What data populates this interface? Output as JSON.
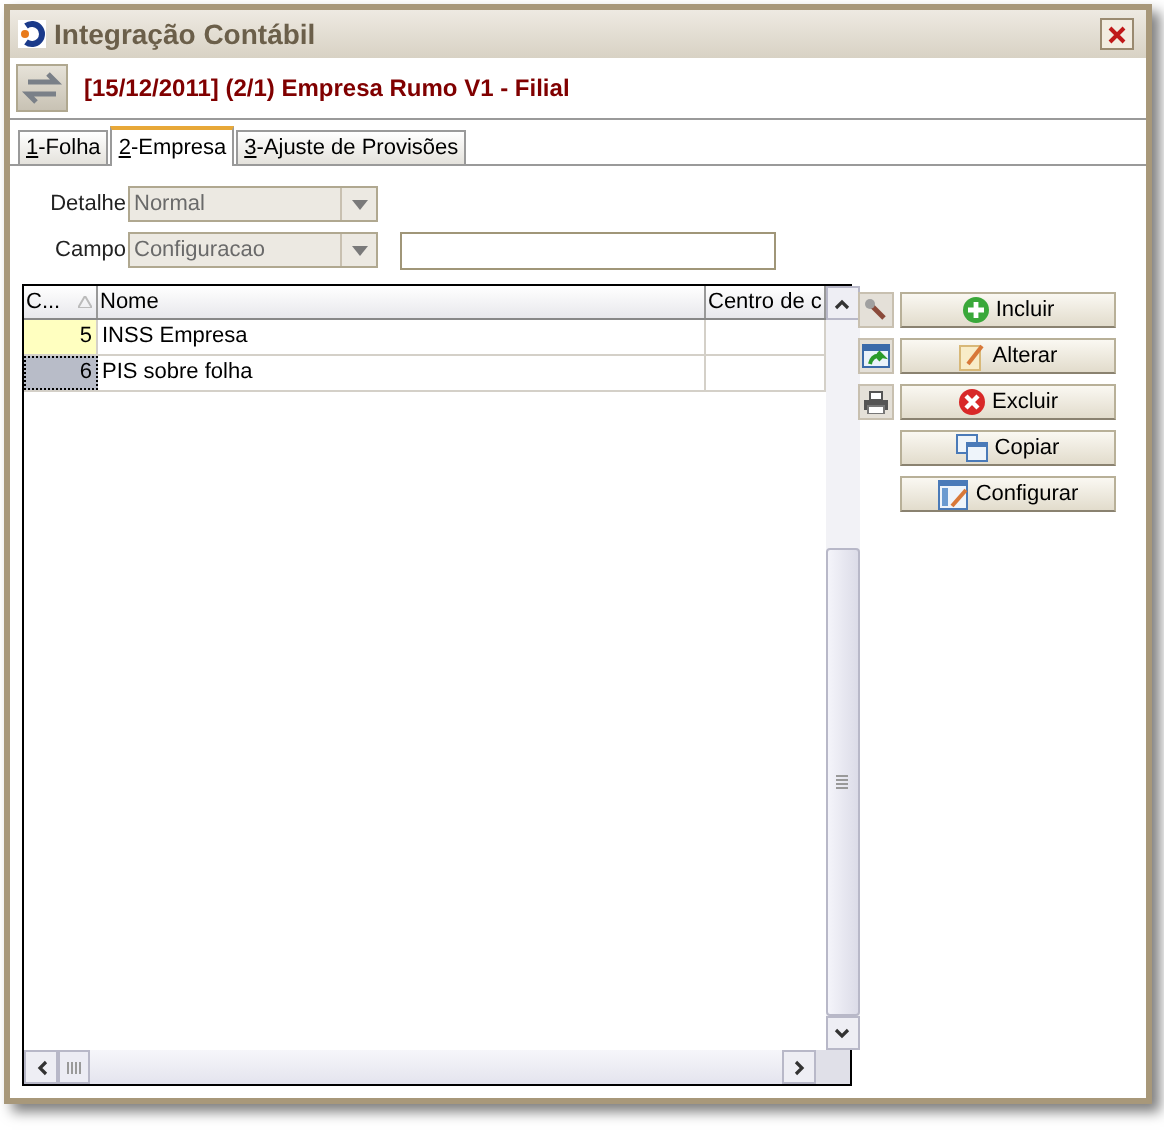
{
  "window": {
    "title": "Integração Contábil"
  },
  "header": {
    "title": "[15/12/2011] (2/1) Empresa Rumo V1 - Filial"
  },
  "tabs": [
    {
      "label": "1-Folha",
      "selected": false
    },
    {
      "label": "2-Empresa",
      "selected": true
    },
    {
      "label": "3-Ajuste de Provisões",
      "selected": false
    }
  ],
  "fields": [
    {
      "label": "Detalhe",
      "value": "Normal",
      "disabled": true
    },
    {
      "label": "Campo",
      "value": "Configuracao",
      "disabled": true
    }
  ],
  "table": {
    "columns": [
      {
        "label": "C...",
        "sorted": true
      },
      {
        "label": "Nome"
      },
      {
        "label": "Centro de c"
      }
    ],
    "rows": [
      {
        "cells": [
          "5",
          "INSS Empresa",
          ""
        ],
        "selected": false
      },
      {
        "cells": [
          "6",
          "PIS sobre folha",
          ""
        ],
        "selected": true
      }
    ]
  },
  "buttons": [
    {
      "label": "Incluir",
      "kind": "add"
    },
    {
      "label": "Alterar",
      "kind": "edit"
    },
    {
      "label": "Excluir",
      "kind": "delete"
    },
    {
      "label": "Copiar",
      "kind": "copy"
    },
    {
      "label": "Configurar",
      "kind": "configure"
    }
  ]
}
